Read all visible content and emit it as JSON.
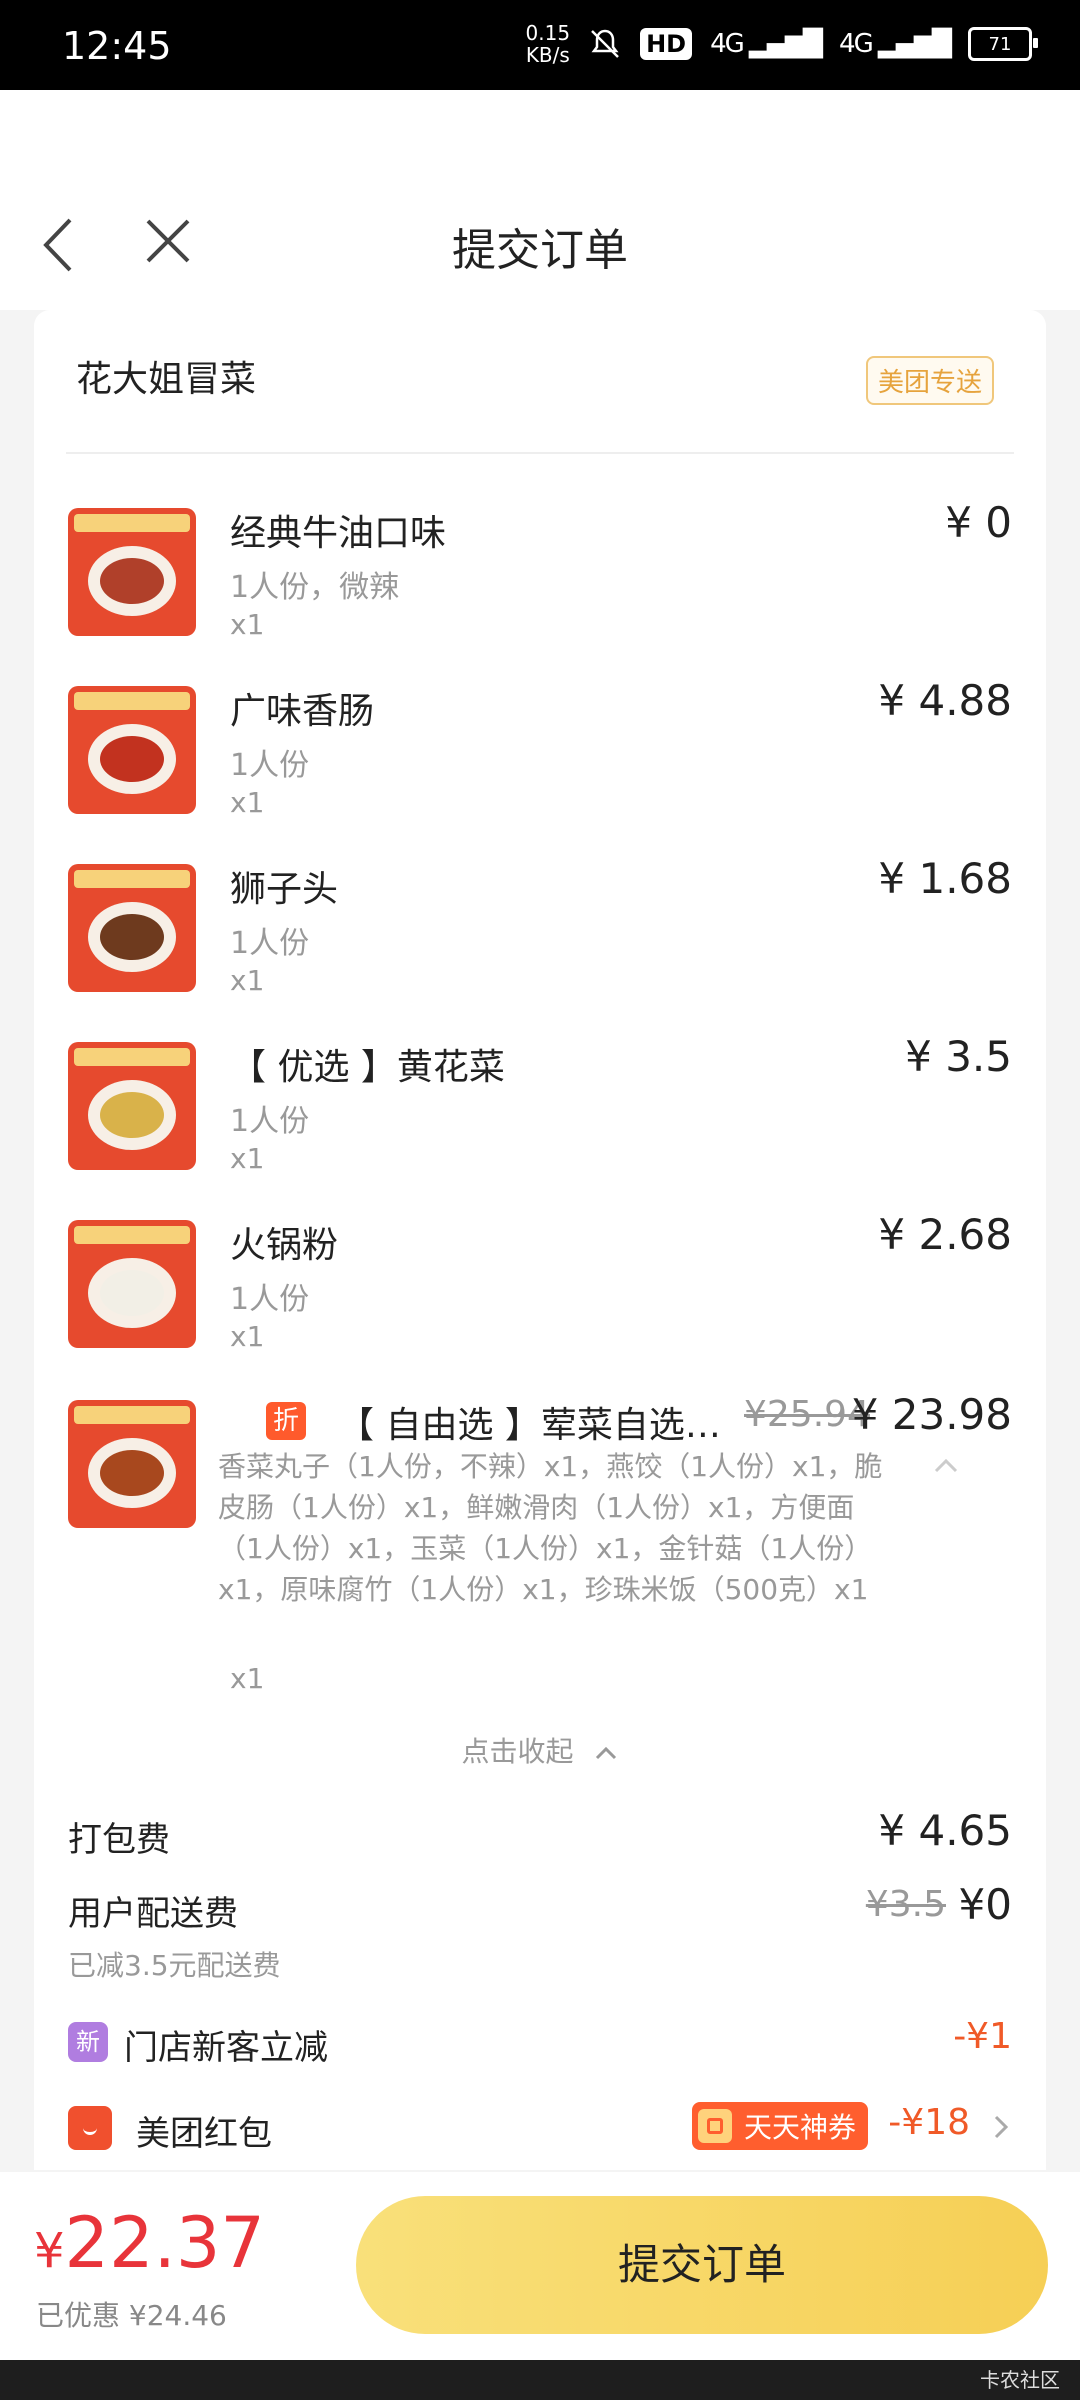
{
  "status_bar": {
    "time": "12:45",
    "speed_value": "0.15",
    "speed_unit": "KB/s",
    "hd_label": "HD",
    "net1": "4G",
    "net2": "4G",
    "battery": "71"
  },
  "header": {
    "title": "提交订单"
  },
  "shop": {
    "name": "花大姐冒菜",
    "delivery_badge": "美团专送"
  },
  "items": [
    {
      "name": "经典牛油口味",
      "spec": "1人份，微辣",
      "qty": "x1",
      "price": "¥ 0"
    },
    {
      "name": "广味香肠",
      "spec": "1人份",
      "qty": "x1",
      "price": "¥ 4.88"
    },
    {
      "name": "狮子头",
      "spec": "1人份",
      "qty": "x1",
      "price": "¥ 1.68"
    },
    {
      "name": "【 优选 】黄花菜",
      "spec": "1人份",
      "qty": "x1",
      "price": "¥ 3.5"
    },
    {
      "name": "火锅粉",
      "spec": "1人份",
      "qty": "x1",
      "price": "¥ 2.68"
    }
  ],
  "combo": {
    "badge": "折",
    "name": "【 自由选 】荤菜自选…",
    "original_price": "¥25.94",
    "price": "¥ 23.98",
    "detail": "香菜丸子（1人份，不辣）x1，燕饺（1人份）x1，脆皮肠（1人份）x1，鲜嫩滑肉（1人份）x1，方便面（1人份）x1，玉菜（1人份）x1，金针菇（1人份）x1，原味腐竹（1人份）x1，珍珠米饭（500克）x1",
    "qty": "x1"
  },
  "collapse_label": "点击收起",
  "fees": {
    "packing_label": "打包费",
    "packing_value": "¥ 4.65",
    "delivery_label": "用户配送费",
    "delivery_original": "¥3.5",
    "delivery_value": "¥0",
    "delivery_note": "已减3.5元配送费"
  },
  "discounts": {
    "new_badge": "新",
    "new_label": "门店新客立减",
    "new_value": "-¥1",
    "hongbao_label": "美团红包",
    "tiantian_label": "天天神券",
    "hongbao_value": "-¥18"
  },
  "bottom": {
    "total_currency": "¥",
    "total_amount": "22.37",
    "saved_text": "已优惠 ¥24.46",
    "submit_label": "提交订单"
  },
  "watermark": "卡农社区",
  "colors": {
    "accent_red": "#e8343a",
    "discount_orange": "#f05a28",
    "button_yellow": "#f6cf55"
  }
}
